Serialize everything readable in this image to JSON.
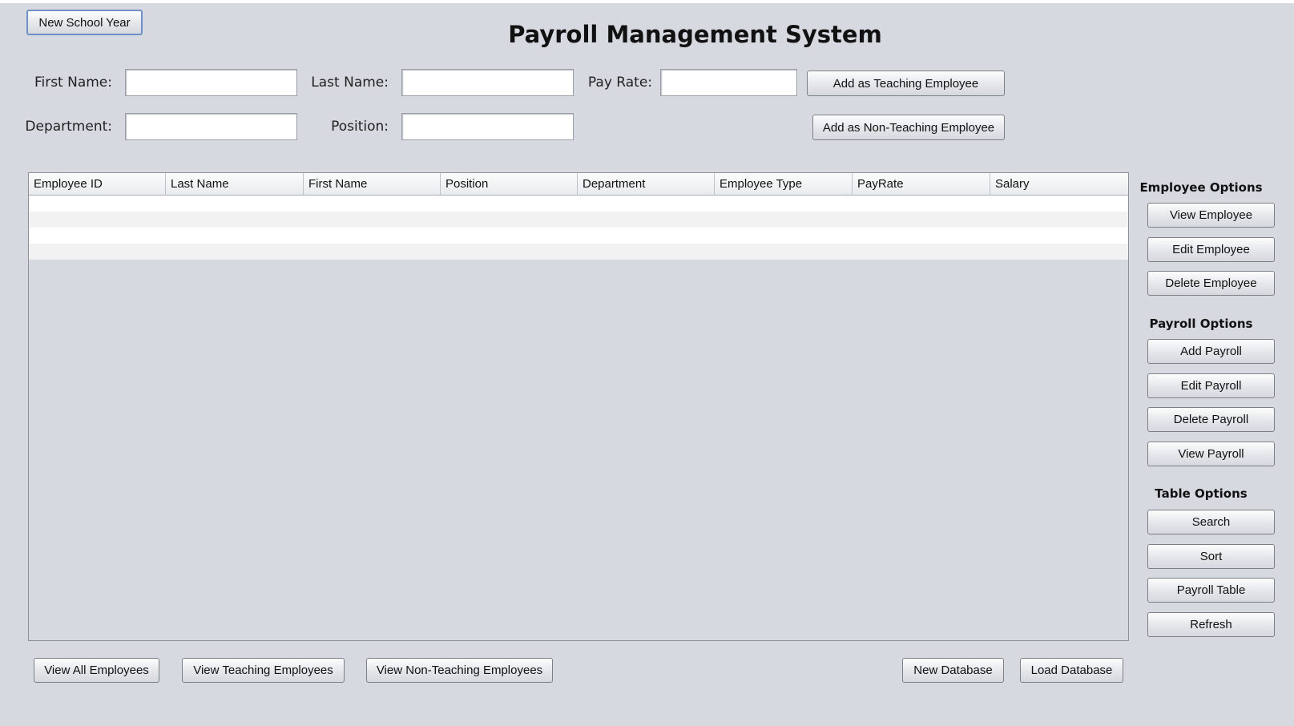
{
  "header": {
    "title": "Payroll Management System",
    "new_school_year": "New School Year"
  },
  "form": {
    "first_name_label": "First Name:",
    "last_name_label": "Last Name:",
    "pay_rate_label": "Pay Rate:",
    "department_label": "Department:",
    "position_label": "Position:",
    "first_name_value": "",
    "last_name_value": "",
    "pay_rate_value": "",
    "department_value": "",
    "position_value": "",
    "add_teaching": "Add as Teaching Employee",
    "add_non_teaching": "Add as Non-Teaching Employee"
  },
  "table": {
    "columns": [
      "Employee ID",
      "Last Name",
      "First Name",
      "Position",
      "Department",
      "Employee Type",
      "PayRate",
      "Salary"
    ],
    "rows": []
  },
  "sidebar": {
    "employee_options": {
      "title": "Employee Options",
      "buttons": [
        "View Employee",
        "Edit Employee",
        "Delete Employee"
      ]
    },
    "payroll_options": {
      "title": "Payroll Options",
      "buttons": [
        "Add Payroll",
        "Edit Payroll",
        "Delete Payroll",
        "View Payroll"
      ]
    },
    "table_options": {
      "title": "Table Options",
      "buttons": [
        "Search",
        "Sort",
        "Payroll Table",
        "Refresh"
      ]
    }
  },
  "bottom": {
    "view_all": "View All Employees",
    "view_teaching": "View Teaching Employees",
    "view_non_teaching": "View Non-Teaching Employees",
    "new_database": "New Database",
    "load_database": "Load Database"
  }
}
